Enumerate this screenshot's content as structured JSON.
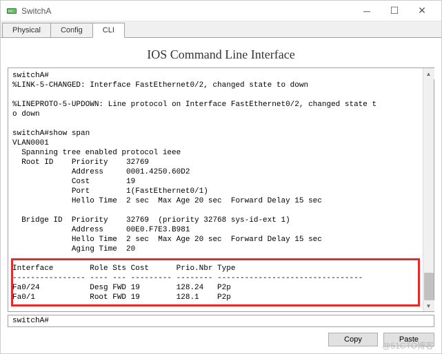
{
  "window": {
    "title": "SwitchA"
  },
  "tabs": {
    "physical": "Physical",
    "config": "Config",
    "cli": "CLI"
  },
  "cli": {
    "heading": "IOS Command Line Interface",
    "output": "switchA#\n%LINK-5-CHANGED: Interface FastEthernet0/2, changed state to down\n\n%LINEPROTO-5-UPDOWN: Line protocol on Interface FastEthernet0/2, changed state t\no down\n\nswitchA#show span\nVLAN0001\n  Spanning tree enabled protocol ieee\n  Root ID    Priority    32769\n             Address     0001.4250.60D2\n             Cost        19\n             Port        1(FastEthernet0/1)\n             Hello Time  2 sec  Max Age 20 sec  Forward Delay 15 sec\n\n  Bridge ID  Priority    32769  (priority 32768 sys-id-ext 1)\n             Address     00E0.F7E3.B981\n             Hello Time  2 sec  Max Age 20 sec  Forward Delay 15 sec\n             Aging Time  20\n\nInterface        Role Sts Cost      Prio.Nbr Type\n---------------- ---- --- --------- -------- --------------------------------\nFa0/24           Desg FWD 19        128.24   P2p\nFa0/1            Root FWD 19        128.1    P2p\n",
    "prompt": "switchA#"
  },
  "buttons": {
    "copy": "Copy",
    "paste": "Paste"
  },
  "watermark": "@51CTO博客"
}
